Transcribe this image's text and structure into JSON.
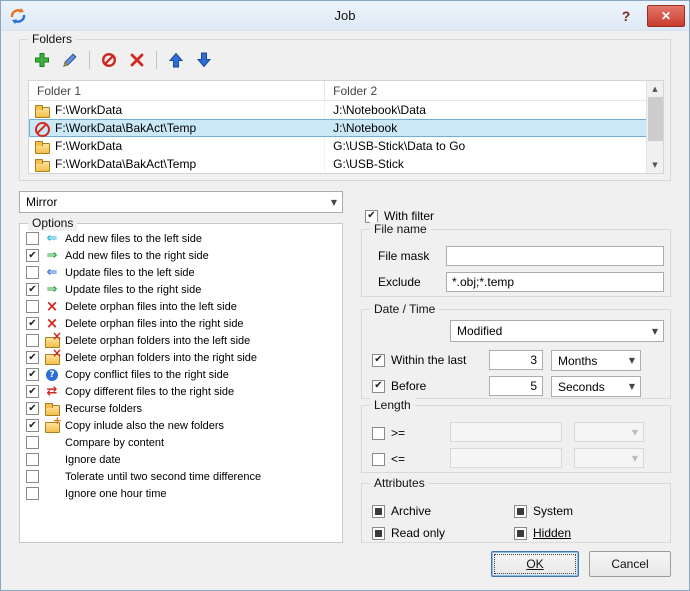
{
  "titlebar": {
    "title": "Job",
    "help_icon": "?",
    "close_icon": "✕",
    "app_icon": "sync-app-icon"
  },
  "folders": {
    "label": "Folders",
    "toolbar_icons": [
      "add-icon",
      "edit-icon",
      "disable-icon",
      "delete-icon",
      "move-up-icon",
      "move-down-icon"
    ],
    "columns": {
      "c1": "Folder 1",
      "c2": "Folder 2"
    },
    "rows": [
      {
        "icon": "folder",
        "selected": false,
        "folder1": "F:\\WorkData",
        "folder2": "J:\\Notebook\\Data"
      },
      {
        "icon": "no-entry",
        "selected": true,
        "folder1": "F:\\WorkData\\BakAct\\Temp",
        "folder2": "J:\\Notebook"
      },
      {
        "icon": "folder",
        "selected": false,
        "folder1": "F:\\WorkData",
        "folder2": "G:\\USB-Stick\\Data to Go"
      },
      {
        "icon": "folder",
        "selected": false,
        "folder1": "F:\\WorkData\\BakAct\\Temp",
        "folder2": "G:\\USB-Stick"
      }
    ]
  },
  "mode": {
    "value": "Mirror"
  },
  "options": {
    "label": "Options",
    "items": [
      {
        "checked": false,
        "icon": "arrow-left-cyan",
        "label": "Add new files to the left side"
      },
      {
        "checked": true,
        "icon": "arrow-right-green",
        "label": "Add new files to the right side"
      },
      {
        "checked": false,
        "icon": "arrow-left-blue",
        "label": "Update files to the left side"
      },
      {
        "checked": true,
        "icon": "arrow-right-green",
        "label": "Update files to the right side"
      },
      {
        "checked": false,
        "icon": "delete-file",
        "label": "Delete orphan files into the left side"
      },
      {
        "checked": true,
        "icon": "delete-file",
        "label": "Delete orphan files into the right side"
      },
      {
        "checked": false,
        "icon": "delete-folder",
        "label": "Delete orphan folders into the left side"
      },
      {
        "checked": true,
        "icon": "delete-folder",
        "label": "Delete orphan folders into the right side"
      },
      {
        "checked": true,
        "icon": "conflict-question",
        "label": "Copy conflict files to the right side"
      },
      {
        "checked": true,
        "icon": "copy-different",
        "label": "Copy different files to the right side"
      },
      {
        "checked": true,
        "icon": "folder",
        "label": "Recurse folders"
      },
      {
        "checked": true,
        "icon": "folder-new",
        "label": "Copy inlude also the new folders"
      },
      {
        "checked": false,
        "icon": "none",
        "label": "Compare by content"
      },
      {
        "checked": false,
        "icon": "none",
        "label": "Ignore date"
      },
      {
        "checked": false,
        "icon": "none",
        "label": "Tolerate until two second time difference"
      },
      {
        "checked": false,
        "icon": "none",
        "label": "Ignore one hour time"
      }
    ]
  },
  "filter": {
    "with_filter": {
      "checked": true,
      "label": "With filter"
    }
  },
  "file_name": {
    "label": "File name",
    "file_mask": {
      "label": "File mask",
      "value": ""
    },
    "exclude": {
      "label": "Exclude",
      "value": "*.obj;*.temp"
    }
  },
  "date_time": {
    "label": "Date / Time",
    "mode": "Modified",
    "within": {
      "checked": true,
      "label": "Within the last",
      "value": "3",
      "unit": "Months"
    },
    "before": {
      "checked": true,
      "label": "Before",
      "value": "5",
      "unit": "Seconds"
    }
  },
  "length": {
    "label": "Length",
    "ge": {
      "checked": false,
      "label": ">=",
      "value": "",
      "unit": ""
    },
    "le": {
      "checked": false,
      "label": "<=",
      "value": "",
      "unit": ""
    }
  },
  "attributes": {
    "label": "Attributes",
    "items": [
      {
        "state": "mixed",
        "label": "Archive"
      },
      {
        "state": "mixed",
        "label": "System"
      },
      {
        "state": "mixed",
        "label": "Read only"
      },
      {
        "state": "mixed",
        "label": "Hidden",
        "underline": true
      }
    ]
  },
  "buttons": {
    "ok": "OK",
    "cancel": "Cancel"
  }
}
